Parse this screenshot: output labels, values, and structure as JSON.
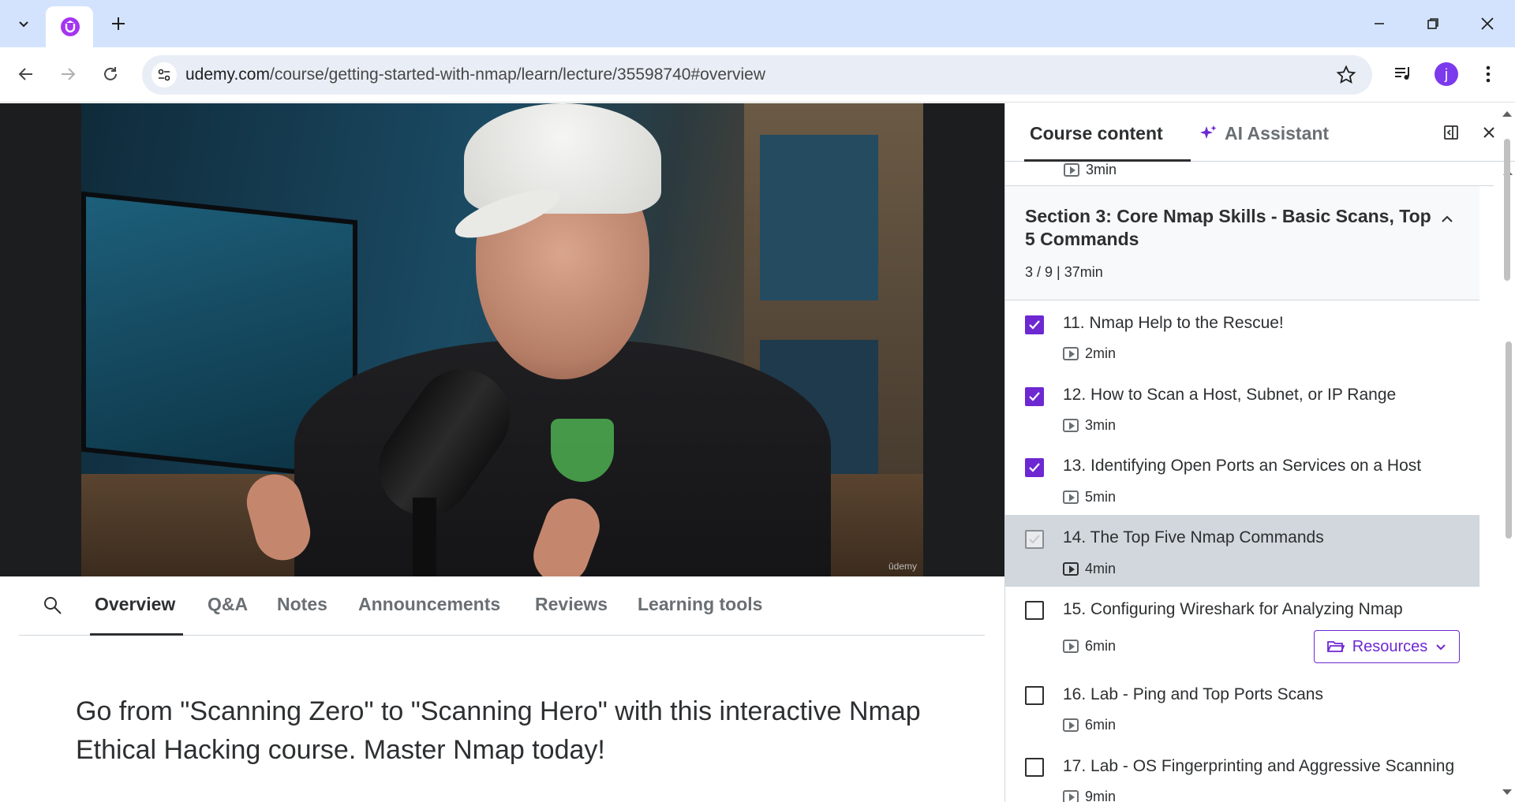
{
  "browser": {
    "url_host": "udemy.com",
    "url_path": "/course/getting-started-with-nmap/learn/lecture/35598740#overview",
    "profile_initial": "j",
    "favicon_letter": "U"
  },
  "main": {
    "tabs": [
      "Overview",
      "Q&A",
      "Notes",
      "Announcements",
      "Reviews",
      "Learning tools"
    ],
    "active_tab": "Overview",
    "headline": "Go from \"Scanning Zero\" to \"Scanning Hero\" with this interactive Nmap Ethical Hacking course. Master Nmap today!",
    "video_watermark": "ûdemy"
  },
  "sidebar": {
    "tab_course_content": "Course content",
    "tab_ai_assistant": "AI Assistant",
    "previous_lecture_duration": "3min",
    "section": {
      "title": "Section 3: Core Nmap Skills - Basic Scans, Top 5 Commands",
      "meta": "3 / 9 | 37min"
    },
    "lectures": [
      {
        "title": "11. Nmap Help to the Rescue!",
        "duration": "2min",
        "completed": true,
        "current": false
      },
      {
        "title": "12. How to Scan a Host, Subnet, or IP Range",
        "duration": "3min",
        "completed": true,
        "current": false
      },
      {
        "title": "13. Identifying Open Ports an Services on a Host",
        "duration": "5min",
        "completed": true,
        "current": false
      },
      {
        "title": "14. The Top Five Nmap Commands",
        "duration": "4min",
        "completed": false,
        "current": true
      },
      {
        "title": "15. Configuring Wireshark for Analyzing Nmap",
        "duration": "6min",
        "completed": false,
        "current": false
      },
      {
        "title": "16. Lab - Ping and Top Ports Scans",
        "duration": "6min",
        "completed": false,
        "current": false
      },
      {
        "title": "17. Lab - OS Fingerprinting and Aggressive Scanning",
        "duration": "9min",
        "completed": false,
        "current": false
      }
    ],
    "resources_label": "Resources"
  },
  "colors": {
    "accent": "#6d28d2",
    "tabstrip": "#d3e3fd",
    "brand": "#a435f0"
  }
}
